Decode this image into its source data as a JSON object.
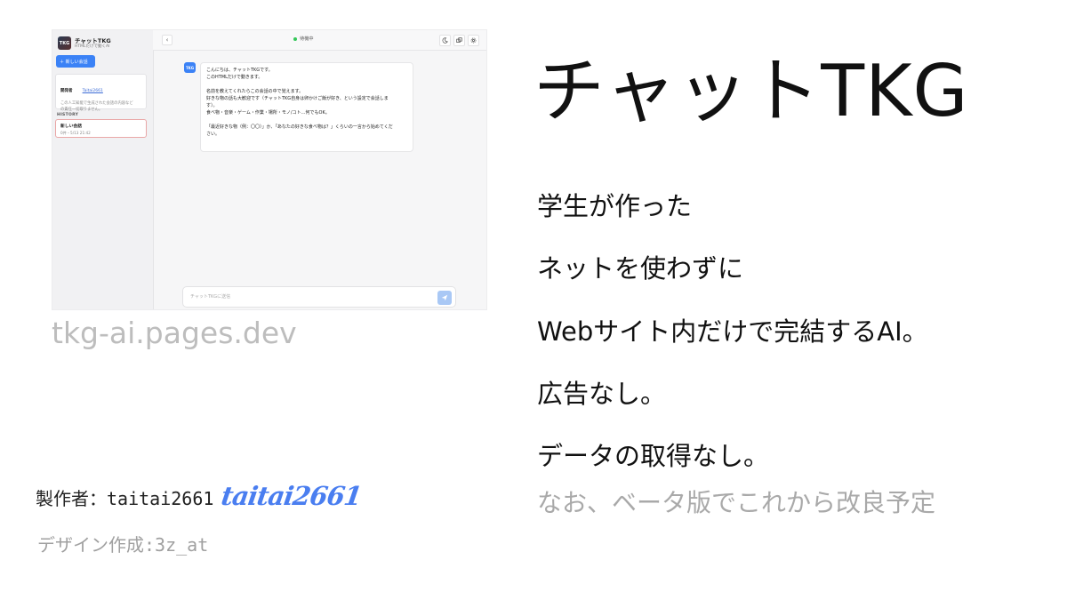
{
  "app": {
    "logo_text": "TKG",
    "name": "チャットTKG",
    "subtitle": "HTMLだけで動くAI",
    "new_chat_label": "＋ 新しい会話",
    "developer_key": "開発者",
    "developer_value": "Taitai2661",
    "developer_note_1": "この人工知能で生成された会話の内容など",
    "developer_note_2": "の責任一切取りません。",
    "history_heading": "HISTORY",
    "history_items": [
      {
        "title": "新しい会話",
        "meta": "0件・5/13 21:42"
      }
    ],
    "back_icon": "‹",
    "status_text": "待機中",
    "status_color": "#34c759",
    "accent_color": "#3b82f6",
    "bot_avatar_text": "TKG",
    "message_lines": [
      "こんにちは、チャットTKGです。",
      "このHTMLだけで動きます。",
      "",
      "名前を教えてくれたらこの会話の中で覚えます。",
      "好きな物の話も大歓迎です（チャットTKG自身は卵かけご飯が好き、という設定で会話しま",
      "す）。",
      "食べ物・音楽・ゲーム・作業・場所・モノ/コト…何でもOK。",
      "",
      "「最近好きな物（例：〇〇）」か、「あなたの好きな食べ物は？」くらいの一言から始めてくだ",
      "さい。"
    ],
    "input_placeholder": "チャットTKGに送信"
  },
  "slide": {
    "title": "チャットTKG",
    "lines": [
      "学生が作った",
      "ネットを使わずに",
      "Webサイト内だけで完結するAI。",
      "広告なし。",
      "データの取得なし。"
    ],
    "note": "なお、ベータ版でこれから改良予定",
    "url": "tkg-ai.pages.dev",
    "maker_label": "製作者：taitai2661",
    "signature": "taitai2661",
    "design_credit": "デザイン作成:3z_at"
  }
}
